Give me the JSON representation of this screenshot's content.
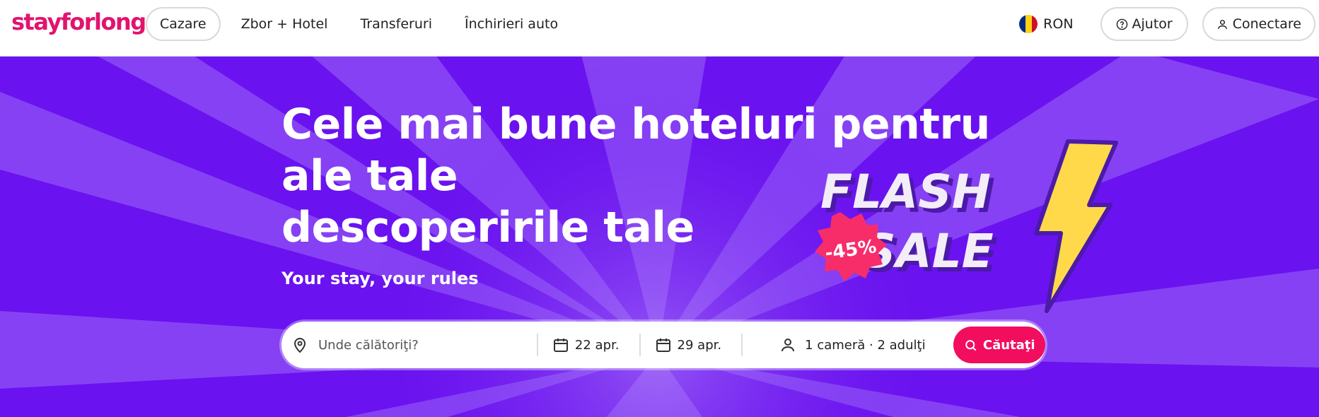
{
  "header": {
    "logo_text": "stayforlong",
    "nav": [
      {
        "label": "Cazare"
      },
      {
        "label": "Zbor + Hotel"
      },
      {
        "label": "Transferuri"
      },
      {
        "label": "Închirieri auto"
      }
    ],
    "currency": "RON",
    "help_label": "Ajutor",
    "login_label": "Conectare"
  },
  "hero": {
    "title_line1": "Cele mai bune hoteluri pentru ale tale",
    "title_line2": "descoperirile tale",
    "subtitle": "Your stay, your rules",
    "promo": {
      "flash_text": "FLASH",
      "sale_text": "SALE",
      "discount": "-45%"
    }
  },
  "search": {
    "destination_placeholder": "Unde călătoriţi?",
    "checkin": "22 apr.",
    "checkout": "29 apr.",
    "guests": "1 cameră · 2 adulţi",
    "button_label": "Căutaţi"
  },
  "colors": {
    "brand": "#e2136e",
    "hero_bg": "#6a12ef",
    "search_button": "#f20d5e",
    "flash_badge": "#f72d6a",
    "bolt": "#ffd94a"
  }
}
